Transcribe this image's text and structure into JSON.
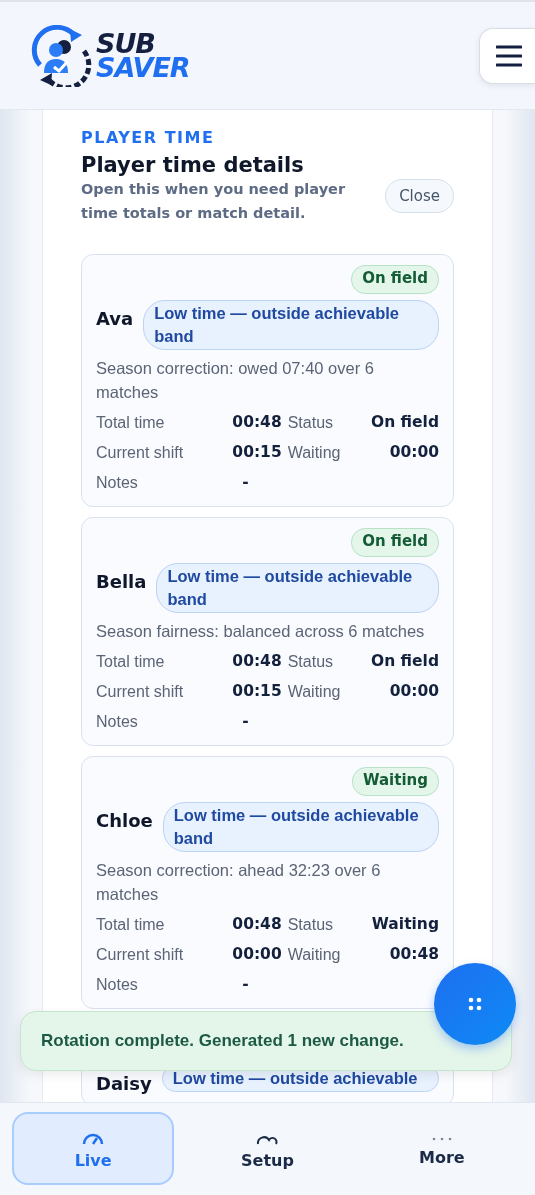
{
  "header": {
    "logo_word_1": "SUB",
    "logo_word_2": "SAVER"
  },
  "panel": {
    "eyebrow": "PLAYER TIME",
    "title": "Player time details",
    "subtitle": "Open this when you need player time totals or match detail.",
    "close_button": "Close"
  },
  "players": [
    {
      "name": "Ava",
      "status": "On field",
      "tag": "Low time — outside achievable band",
      "season_note": "Season correction: owed 07:40 over 6 matches",
      "stats": [
        {
          "label": "Total time",
          "value": "00:48"
        },
        {
          "label": "Status",
          "value": "On field"
        },
        {
          "label": "Current shift",
          "value": "00:15"
        },
        {
          "label": "Waiting",
          "value": "00:00"
        },
        {
          "label": "Notes",
          "value": "-"
        }
      ]
    },
    {
      "name": "Bella",
      "status": "On field",
      "tag": "Low time — outside achievable band",
      "season_note": "Season fairness: balanced across 6 matches",
      "stats": [
        {
          "label": "Total time",
          "value": "00:48"
        },
        {
          "label": "Status",
          "value": "On field"
        },
        {
          "label": "Current shift",
          "value": "00:15"
        },
        {
          "label": "Waiting",
          "value": "00:00"
        },
        {
          "label": "Notes",
          "value": "-"
        }
      ]
    },
    {
      "name": "Chloe",
      "status": "Waiting",
      "tag": "Low time — outside achievable band",
      "season_note": "Season correction: ahead 32:23 over 6 matches",
      "stats": [
        {
          "label": "Total time",
          "value": "00:48"
        },
        {
          "label": "Status",
          "value": "Waiting"
        },
        {
          "label": "Current shift",
          "value": "00:00"
        },
        {
          "label": "Waiting",
          "value": "00:48"
        },
        {
          "label": "Notes",
          "value": "-"
        }
      ]
    },
    {
      "name": "Daisy",
      "tag": "Low time — outside achievable"
    }
  ],
  "toast": "Rotation complete. Generated 1 new change.",
  "nav": [
    {
      "label": "Live",
      "selected": true
    },
    {
      "label": "Setup",
      "selected": false
    },
    {
      "label": "More",
      "selected": false
    }
  ]
}
